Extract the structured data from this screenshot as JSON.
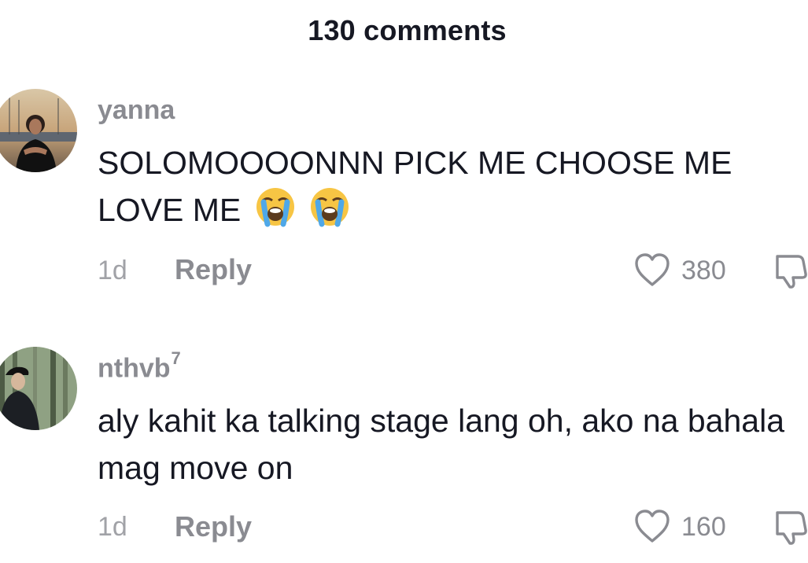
{
  "header": {
    "title": "130 comments"
  },
  "comments": [
    {
      "username": "yanna",
      "username_sup": "",
      "text": "SOLOMOOOONNN PICK ME CHOOSE ME LOVE ME",
      "emojis": [
        "loudly-crying-face",
        "loudly-crying-face"
      ],
      "time": "1d",
      "reply_label": "Reply",
      "likes": "380"
    },
    {
      "username": "nthvb",
      "username_sup": "7",
      "text": "aly kahit ka talking stage lang oh, ako na bahala mag move on",
      "emojis": [],
      "time": "1d",
      "reply_label": "Reply",
      "likes": "160"
    }
  ],
  "colors": {
    "primary_text": "#161823",
    "secondary_text": "#8a8b91",
    "background": "#ffffff"
  }
}
